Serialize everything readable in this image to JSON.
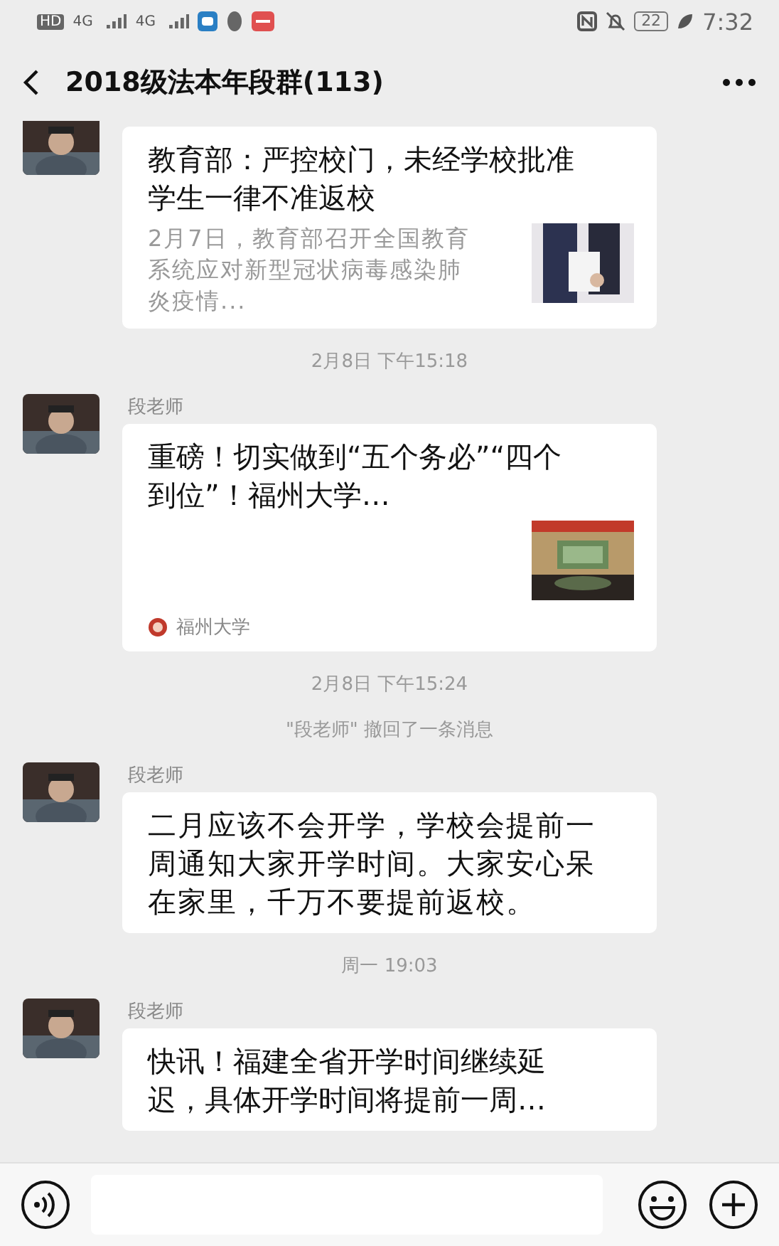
{
  "status_bar": {
    "hd": "HD",
    "networks": [
      "4G",
      "4G"
    ],
    "battery": "22",
    "time": "7:32"
  },
  "header": {
    "title": "2018级法本年段群(113)"
  },
  "items": [
    {
      "kind": "link",
      "title": "教育部：严控校门，未经学校批准学生一律不准返校",
      "description": "2月7日，教育部召开全国教育系统应对新型冠状病毒感染肺炎疫情..."
    },
    {
      "kind": "time",
      "text": "2月8日 下午15:18"
    },
    {
      "kind": "link",
      "sender": "段老师",
      "title": "重磅！切实做到“五个务必”“四个到位”！福州大学…",
      "source": "福州大学"
    },
    {
      "kind": "time",
      "text": "2月8日 下午15:24"
    },
    {
      "kind": "notice",
      "text": "\"段老师\" 撤回了一条消息"
    },
    {
      "kind": "text",
      "sender": "段老师",
      "text": "二月应该不会开学，学校会提前一周通知大家开学时间。大家安心呆在家里，千万不要提前返校。"
    },
    {
      "kind": "time",
      "text": "周一 19:03"
    },
    {
      "kind": "link",
      "sender": "段老师",
      "title": "快讯！福建全省开学时间继续延迟，具体开学时间将提前一周…"
    }
  ]
}
